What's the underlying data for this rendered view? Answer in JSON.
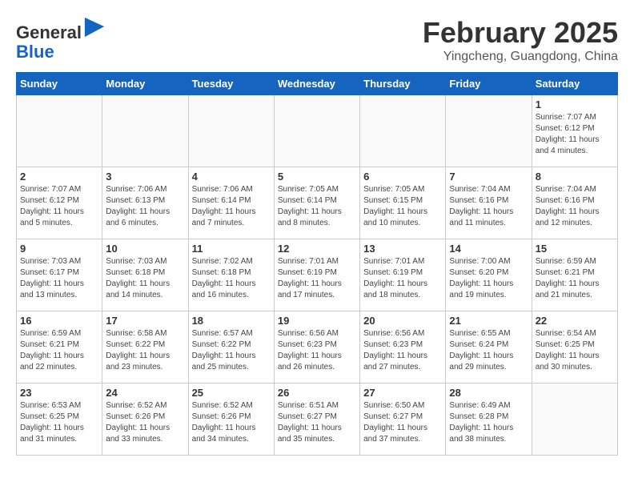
{
  "header": {
    "logo": {
      "general": "General",
      "blue": "Blue",
      "icon_alt": "GeneralBlue logo"
    },
    "title": "February 2025",
    "subtitle": "Yingcheng, Guangdong, China"
  },
  "weekdays": [
    "Sunday",
    "Monday",
    "Tuesday",
    "Wednesday",
    "Thursday",
    "Friday",
    "Saturday"
  ],
  "weeks": [
    [
      {
        "day": "",
        "info": ""
      },
      {
        "day": "",
        "info": ""
      },
      {
        "day": "",
        "info": ""
      },
      {
        "day": "",
        "info": ""
      },
      {
        "day": "",
        "info": ""
      },
      {
        "day": "",
        "info": ""
      },
      {
        "day": "1",
        "info": "Sunrise: 7:07 AM\nSunset: 6:12 PM\nDaylight: 11 hours and 4 minutes."
      }
    ],
    [
      {
        "day": "2",
        "info": "Sunrise: 7:07 AM\nSunset: 6:12 PM\nDaylight: 11 hours and 5 minutes."
      },
      {
        "day": "3",
        "info": "Sunrise: 7:06 AM\nSunset: 6:13 PM\nDaylight: 11 hours and 6 minutes."
      },
      {
        "day": "4",
        "info": "Sunrise: 7:06 AM\nSunset: 6:14 PM\nDaylight: 11 hours and 7 minutes."
      },
      {
        "day": "5",
        "info": "Sunrise: 7:05 AM\nSunset: 6:14 PM\nDaylight: 11 hours and 8 minutes."
      },
      {
        "day": "6",
        "info": "Sunrise: 7:05 AM\nSunset: 6:15 PM\nDaylight: 11 hours and 10 minutes."
      },
      {
        "day": "7",
        "info": "Sunrise: 7:04 AM\nSunset: 6:16 PM\nDaylight: 11 hours and 11 minutes."
      },
      {
        "day": "8",
        "info": "Sunrise: 7:04 AM\nSunset: 6:16 PM\nDaylight: 11 hours and 12 minutes."
      }
    ],
    [
      {
        "day": "9",
        "info": "Sunrise: 7:03 AM\nSunset: 6:17 PM\nDaylight: 11 hours and 13 minutes."
      },
      {
        "day": "10",
        "info": "Sunrise: 7:03 AM\nSunset: 6:18 PM\nDaylight: 11 hours and 14 minutes."
      },
      {
        "day": "11",
        "info": "Sunrise: 7:02 AM\nSunset: 6:18 PM\nDaylight: 11 hours and 16 minutes."
      },
      {
        "day": "12",
        "info": "Sunrise: 7:01 AM\nSunset: 6:19 PM\nDaylight: 11 hours and 17 minutes."
      },
      {
        "day": "13",
        "info": "Sunrise: 7:01 AM\nSunset: 6:19 PM\nDaylight: 11 hours and 18 minutes."
      },
      {
        "day": "14",
        "info": "Sunrise: 7:00 AM\nSunset: 6:20 PM\nDaylight: 11 hours and 19 minutes."
      },
      {
        "day": "15",
        "info": "Sunrise: 6:59 AM\nSunset: 6:21 PM\nDaylight: 11 hours and 21 minutes."
      }
    ],
    [
      {
        "day": "16",
        "info": "Sunrise: 6:59 AM\nSunset: 6:21 PM\nDaylight: 11 hours and 22 minutes."
      },
      {
        "day": "17",
        "info": "Sunrise: 6:58 AM\nSunset: 6:22 PM\nDaylight: 11 hours and 23 minutes."
      },
      {
        "day": "18",
        "info": "Sunrise: 6:57 AM\nSunset: 6:22 PM\nDaylight: 11 hours and 25 minutes."
      },
      {
        "day": "19",
        "info": "Sunrise: 6:56 AM\nSunset: 6:23 PM\nDaylight: 11 hours and 26 minutes."
      },
      {
        "day": "20",
        "info": "Sunrise: 6:56 AM\nSunset: 6:23 PM\nDaylight: 11 hours and 27 minutes."
      },
      {
        "day": "21",
        "info": "Sunrise: 6:55 AM\nSunset: 6:24 PM\nDaylight: 11 hours and 29 minutes."
      },
      {
        "day": "22",
        "info": "Sunrise: 6:54 AM\nSunset: 6:25 PM\nDaylight: 11 hours and 30 minutes."
      }
    ],
    [
      {
        "day": "23",
        "info": "Sunrise: 6:53 AM\nSunset: 6:25 PM\nDaylight: 11 hours and 31 minutes."
      },
      {
        "day": "24",
        "info": "Sunrise: 6:52 AM\nSunset: 6:26 PM\nDaylight: 11 hours and 33 minutes."
      },
      {
        "day": "25",
        "info": "Sunrise: 6:52 AM\nSunset: 6:26 PM\nDaylight: 11 hours and 34 minutes."
      },
      {
        "day": "26",
        "info": "Sunrise: 6:51 AM\nSunset: 6:27 PM\nDaylight: 11 hours and 35 minutes."
      },
      {
        "day": "27",
        "info": "Sunrise: 6:50 AM\nSunset: 6:27 PM\nDaylight: 11 hours and 37 minutes."
      },
      {
        "day": "28",
        "info": "Sunrise: 6:49 AM\nSunset: 6:28 PM\nDaylight: 11 hours and 38 minutes."
      },
      {
        "day": "",
        "info": ""
      }
    ]
  ]
}
